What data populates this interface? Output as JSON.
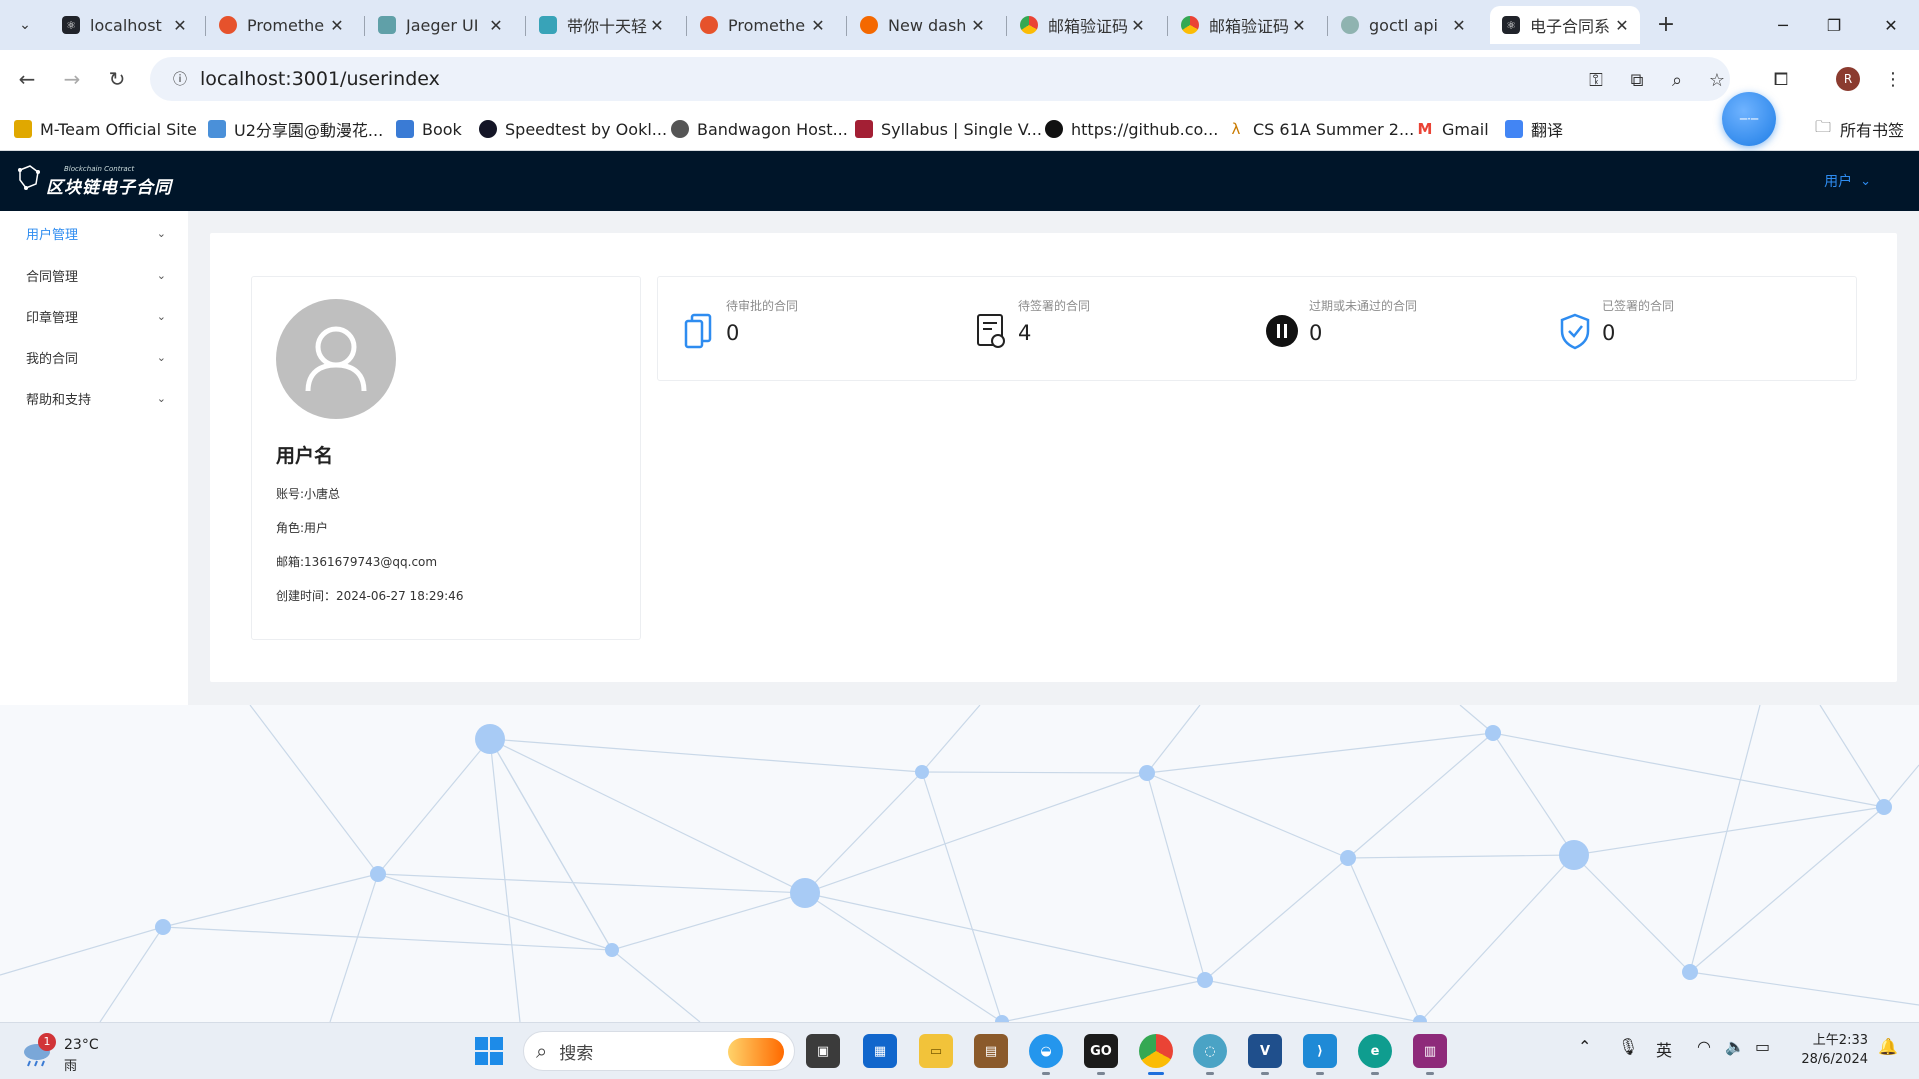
{
  "browser": {
    "tabs": [
      {
        "title": "localhost",
        "favicon": "react-icon",
        "color": "#20232a"
      },
      {
        "title": "Promethe",
        "favicon": "prometheus-icon",
        "color": "#e6522c"
      },
      {
        "title": "Jaeger UI",
        "favicon": "jaeger-icon",
        "color": "#60a0a8"
      },
      {
        "title": "带你十天轻",
        "favicon": "book-icon",
        "color": "#38a3b8"
      },
      {
        "title": "Promethe",
        "favicon": "prometheus-icon",
        "color": "#e6522c"
      },
      {
        "title": "New dash",
        "favicon": "grafana-icon",
        "color": "#f46800"
      },
      {
        "title": "邮箱验证码",
        "favicon": "chrome-icon",
        "color": "#4285f4"
      },
      {
        "title": "邮箱验证码",
        "favicon": "chrome-icon",
        "color": "#4285f4"
      },
      {
        "title": "goctl api",
        "favicon": "gear-icon",
        "color": "#8fb3b0"
      },
      {
        "title": "电子合同系",
        "favicon": "react-icon",
        "color": "#20232a",
        "active": true
      }
    ],
    "url": "localhost:3001/userindex",
    "bookmarks": [
      {
        "label": "M-Team Official Site",
        "icon": "mteam-icon",
        "color": "#e0a800"
      },
      {
        "label": "U2分享園@動漫花...",
        "icon": "u2-icon",
        "color": "#4a90d9"
      },
      {
        "label": "Book",
        "icon": "book-icon",
        "color": "#3a7bd5"
      },
      {
        "label": "Speedtest by Ookl...",
        "icon": "speedtest-icon",
        "color": "#141526"
      },
      {
        "label": "Bandwagon Host...",
        "icon": "globe-icon",
        "color": "#555"
      },
      {
        "label": "Syllabus | Single V...",
        "icon": "mit-icon",
        "color": "#a31f34"
      },
      {
        "label": "https://github.co...",
        "icon": "github-icon",
        "color": "#111"
      },
      {
        "label": "CS 61A Summer 2...",
        "icon": "lambda-icon",
        "color": "#c97a00"
      },
      {
        "label": "Gmail",
        "icon": "gmail-icon",
        "color": "#ea4335"
      },
      {
        "label": "翻译",
        "icon": "translate-icon",
        "color": "#4285f4"
      }
    ],
    "all_bookmarks": "所有书签",
    "profile_initial": "R"
  },
  "app": {
    "logo_text": "区块链电子合同",
    "logo_sub": "Blockchain Contract",
    "user_menu": "用户",
    "menu": [
      {
        "label": "用户管理",
        "active": true
      },
      {
        "label": "合同管理"
      },
      {
        "label": "印章管理"
      },
      {
        "label": "我的合同"
      },
      {
        "label": "帮助和支持"
      }
    ],
    "profile": {
      "name": "用户名",
      "account": "账号:小唐总",
      "role": "角色:用户",
      "email": "邮箱:1361679743@qq.com",
      "created": "创建时间：2024-06-27 18:29:46"
    },
    "stats": [
      {
        "label": "待审批的合同",
        "value": "0",
        "icon": "document-copy-icon"
      },
      {
        "label": "待签署的合同",
        "value": "4",
        "icon": "document-sync-icon"
      },
      {
        "label": "过期或未通过的合同",
        "value": "0",
        "icon": "pause-icon"
      },
      {
        "label": "已签署的合同",
        "value": "0",
        "icon": "shield-check-icon"
      }
    ],
    "accent": "#2e8cf0",
    "header_bg": "#001529"
  },
  "taskbar": {
    "weather_badge": "1",
    "temperature": "23°C",
    "condition": "雨",
    "search_placeholder": "搜索",
    "ime": "英",
    "time": "上午2:33",
    "date": "28/6/2024"
  }
}
